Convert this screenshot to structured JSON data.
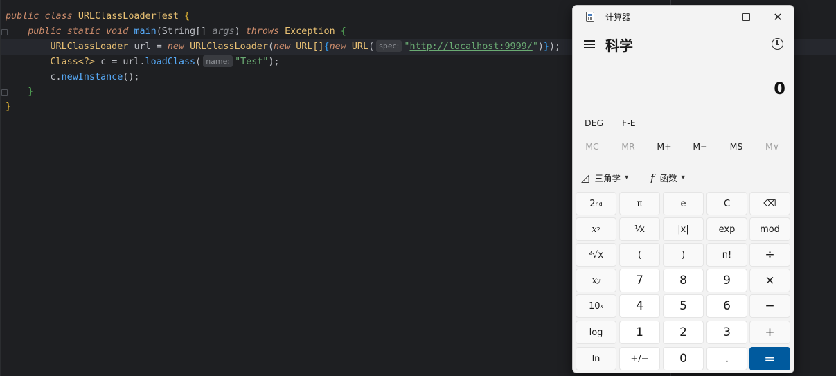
{
  "editor": {
    "lines": {
      "l1": {
        "kw1": "public",
        "kw2": "class",
        "name": "URLClassLoaderTest",
        "brace": "{"
      },
      "l2": {
        "kw1": "public",
        "kw2": "static",
        "kw3": "void",
        "method": "main",
        "params_open": "(",
        "param_type": "String[]",
        "param_name": "args",
        "params_close": ")",
        "throws": "throws",
        "exception": "Exception",
        "brace": "{"
      },
      "l3": {
        "type": "URLClassLoader",
        "var": "url",
        "eq": "=",
        "new1": "new",
        "ctor": "URLClassLoader",
        "p1": "(",
        "new2": "new",
        "arr": "URL[]",
        "b1": "{",
        "new3": "new",
        "url_ctor": "URL",
        "p2": "(",
        "hint": "spec:",
        "q1": "\"",
        "url_value": "http://localhost:9999/",
        "q2": "\"",
        "p3": ")",
        "b2": "}",
        "p4": ");"
      },
      "l4": {
        "type": "Class<?>",
        "var": "c",
        "eq": "=",
        "obj": "url.",
        "method": "loadClass",
        "p1": "(",
        "hint": "name:",
        "str": "\"Test\"",
        "end": ");"
      },
      "l5": {
        "obj": "c.",
        "method": "newInstance",
        "end": "();"
      },
      "l6": {
        "brace": "}"
      },
      "l7": {
        "brace": "}"
      }
    }
  },
  "calculator": {
    "window_title": "计算器",
    "mode": "科学",
    "display_value": "0",
    "angle_unit": "DEG",
    "fe_label": "F-E",
    "memory": [
      "MC",
      "MR",
      "M+",
      "M−",
      "MS",
      "M∨"
    ],
    "trig_label": "三角学",
    "func_label": "函数",
    "keys": {
      "second": "2",
      "second_sup": "nd",
      "pi": "π",
      "e": "e",
      "clear": "C",
      "backspace": "⌫",
      "square": "x",
      "square_sup": "2",
      "reciprocal": "¹⁄x",
      "abs": "|x|",
      "exp": "exp",
      "mod": "mod",
      "sqrt": "²√x",
      "lparen": "(",
      "rparen": ")",
      "factorial": "n!",
      "divide": "÷",
      "power": "x",
      "power_sup": "y",
      "n7": "7",
      "n8": "8",
      "n9": "9",
      "multiply": "×",
      "tenpow": "10",
      "tenpow_sup": "x",
      "n4": "4",
      "n5": "5",
      "n6": "6",
      "minus": "−",
      "log": "log",
      "n1": "1",
      "n2": "2",
      "n3": "3",
      "plus": "+",
      "ln": "ln",
      "negate": "+/−",
      "n0": "0",
      "decimal": ".",
      "equals": "="
    }
  }
}
